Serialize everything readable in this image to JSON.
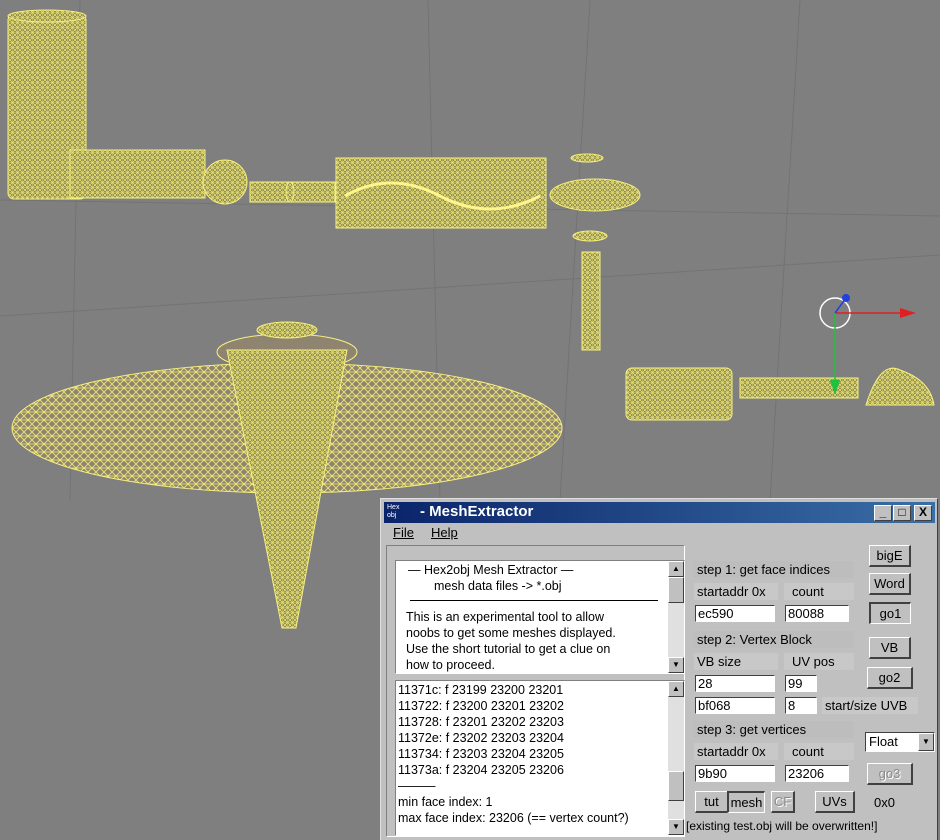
{
  "window": {
    "title": "- MeshExtractor",
    "icon_text": [
      "Hex",
      "obj"
    ],
    "min_glyph": "_",
    "max_glyph": "□",
    "close_glyph": "X"
  },
  "menu": {
    "file": "File",
    "help": "Help"
  },
  "info_box": {
    "line1": "—    Hex2obj Mesh Extractor    —",
    "line2": "mesh data files -> *.obj",
    "line3": "This is an experimental tool to allow",
    "line4": "noobs to get some meshes displayed.",
    "line5": "Use the short tutorial to get a clue on",
    "line6": "how to proceed."
  },
  "log_box": {
    "lines": [
      "11371c: f  23199 23200 23201",
      "113722: f  23200 23201 23202",
      "113728: f  23201 23202 23203",
      "11372e: f  23202 23203 23204",
      "113734: f  23203 23204 23205",
      "11373a: f  23204 23205 23206"
    ],
    "separator": "———",
    "min_line": "min face index: 1",
    "max_line": "max face index: 23206 (== vertex count?)"
  },
  "step1": {
    "label": "step 1: get face indices",
    "startaddr_label": "startaddr 0x",
    "count_label": "count",
    "startaddr_value": "ec590",
    "count_value": "80088"
  },
  "step2": {
    "label": "step 2: Vertex Block",
    "vbsize_label": "VB size",
    "uvpos_label": "UV pos",
    "vbsize_value": "28",
    "uvpos_value": "99",
    "uvb_addr_value": "bf068",
    "uvb_size_value": "8",
    "uvb_label": "start/size UVB"
  },
  "step3": {
    "label": "step 3: get vertices",
    "startaddr_label": "startaddr 0x",
    "count_label": "count",
    "startaddr_value": "9b90",
    "count_value": "23206"
  },
  "buttons": {
    "bigE": "bigE",
    "word": "Word",
    "go1": "go1",
    "vb": "VB",
    "go2": "go2",
    "go3": "go3",
    "tut": "tut",
    "mesh": "mesh",
    "cf": "CF",
    "uvs": "UVs",
    "hex": "0x0"
  },
  "format_select": {
    "selected": "Float"
  },
  "status_text": "[existing test.obj will be overwritten!]",
  "colors": {
    "mesh": "#f0ea6a",
    "background": "#7f7f7f",
    "title_start": "#0a246a"
  }
}
